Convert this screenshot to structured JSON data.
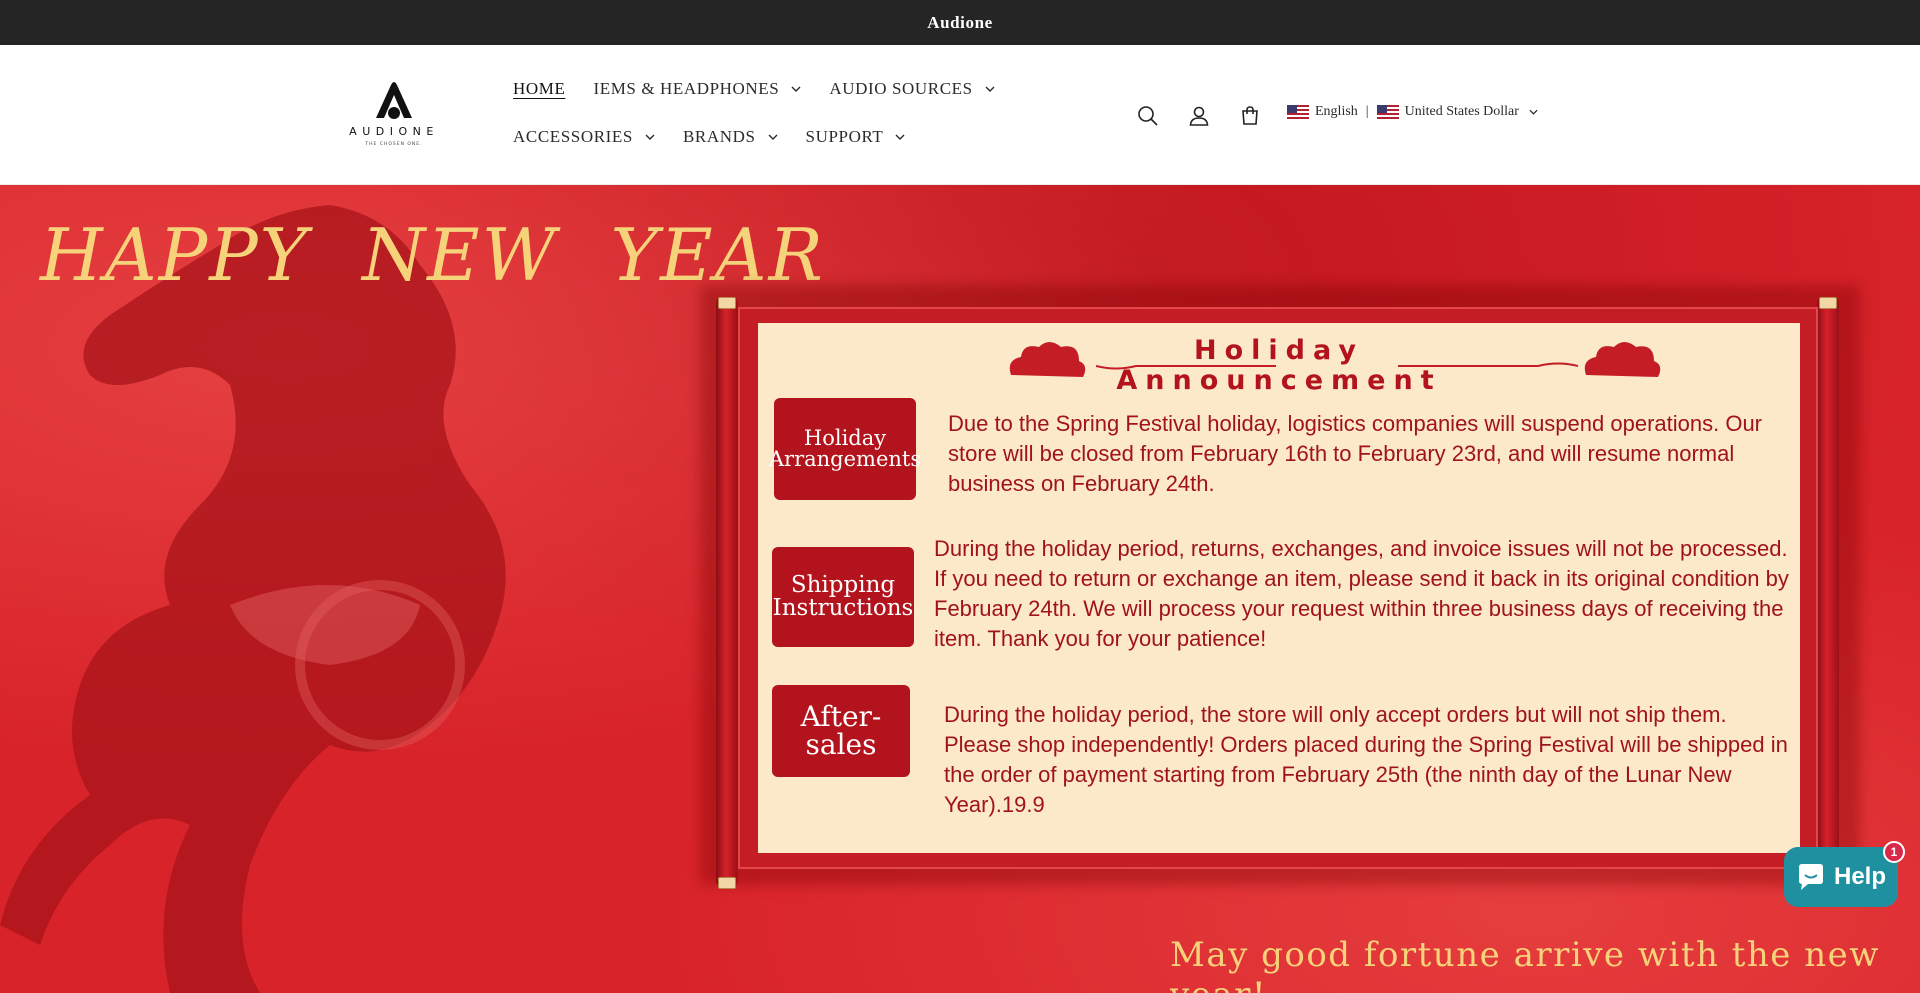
{
  "announcement": {
    "text": "Audione"
  },
  "logo": {
    "name": "AUDIONE",
    "tagline": "THE CHOSEN ONE."
  },
  "nav": {
    "row1": [
      {
        "label": "HOME",
        "active": true,
        "has_dropdown": false
      },
      {
        "label": "IEMS & HEADPHONES",
        "has_dropdown": true
      },
      {
        "label": "AUDIO SOURCES",
        "has_dropdown": true
      }
    ],
    "row2": [
      {
        "label": "ACCESSORIES",
        "has_dropdown": true
      },
      {
        "label": "BRANDS",
        "has_dropdown": true
      },
      {
        "label": "SUPPORT",
        "has_dropdown": true
      }
    ]
  },
  "header_icons": [
    "search-icon",
    "account-icon",
    "cart-icon"
  ],
  "locale": {
    "language": "English",
    "separator": "|",
    "currency": "United States Dollar"
  },
  "hero": {
    "headline": "HAPPY NEW YEAR",
    "footer": "May good fortune arrive with the new year!",
    "announcement": {
      "title_line1": "Holiday",
      "title_line2": "Announcement",
      "sections": [
        {
          "label": "Holiday Arrangements",
          "text": "Due to the Spring Festival holiday, logistics companies will suspend operations. Our store will be closed from February 16th to February 23rd, and will resume normal business on February 24th."
        },
        {
          "label": "Shipping Instructions",
          "text": "During the holiday period, returns, exchanges, and invoice issues will not be processed. If you need to return or exchange an item, please send it back in its original condition by February 24th. We will process your request within three business days of receiving the item. Thank you for your patience!"
        },
        {
          "label": "After-sales",
          "text": "During the holiday period, the store will only accept orders but will not ship them. Please shop independently! Orders placed during the Spring Festival will be shipped in the order of payment starting from February 25th (the ninth day of the Lunar New Year).19.9"
        }
      ]
    }
  },
  "help_widget": {
    "label": "Help",
    "badge": "1"
  },
  "colors": {
    "accent_red": "#d8232a",
    "dark_red": "#b3131c",
    "gold": "#f6d37a",
    "help_teal": "#1f90a0",
    "badge": "#d9284a"
  }
}
